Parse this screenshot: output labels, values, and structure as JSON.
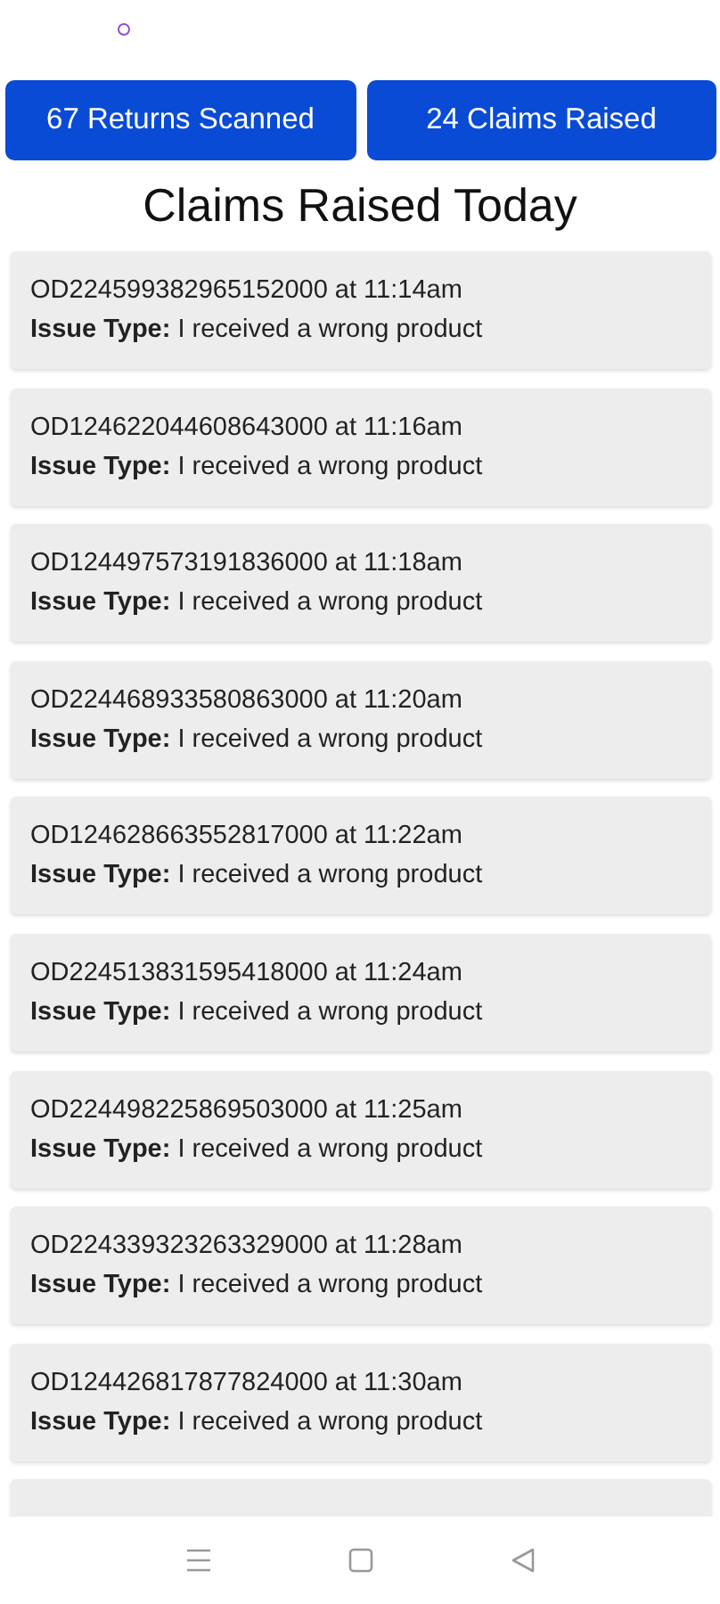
{
  "stats": [
    {
      "label": "67 Returns Scanned"
    },
    {
      "label": "24 Claims Raised"
    }
  ],
  "title": "Claims Raised Today",
  "claims": [
    {
      "kind": "claim",
      "order": "OD224599382965152000 at 11:14am",
      "issue": "**Issue Type:** I received a wrong product"
    },
    {
      "kind": "claim",
      "order": "OD124622044608643000 at 11:16am",
      "issue": "**Issue Type:** I received a wrong product"
    },
    {
      "kind": "claim",
      "order": "OD124497573191836000 at 11:18am",
      "issue": "**Issue Type:** I received a wrong product"
    },
    {
      "kind": "claim",
      "order": "OD224468933580863000 at 11:20am",
      "issue": "**Issue Type:** I received a wrong product"
    },
    {
      "kind": "claim",
      "order": "OD124628663552817000 at 11:22am",
      "issue": "**Issue Type:** I received a wrong product"
    },
    {
      "kind": "claim",
      "order": "OD224513831595418000 at 11:24am",
      "issue": "**Issue Type:** I received a wrong product"
    },
    {
      "kind": "claim",
      "order": "OD224498225869503000 at 11:25am",
      "issue": "**Issue Type:** I received a wrong product"
    },
    {
      "kind": "claim",
      "order": "OD224339323263329000 at 11:28am",
      "issue": "**Issue Type:** I received a wrong product"
    },
    {
      "kind": "claim",
      "order": "OD124426817877824000 at 11:30am",
      "issue": "**Issue Type:** I received a wrong product"
    },
    {
      "kind": "cut"
    }
  ],
  "nav_bar": {
    "buttons": [
      {
        "kind": "menu"
      },
      {
        "kind": "home"
      },
      {
        "kind": "back"
      }
    ]
  }
}
